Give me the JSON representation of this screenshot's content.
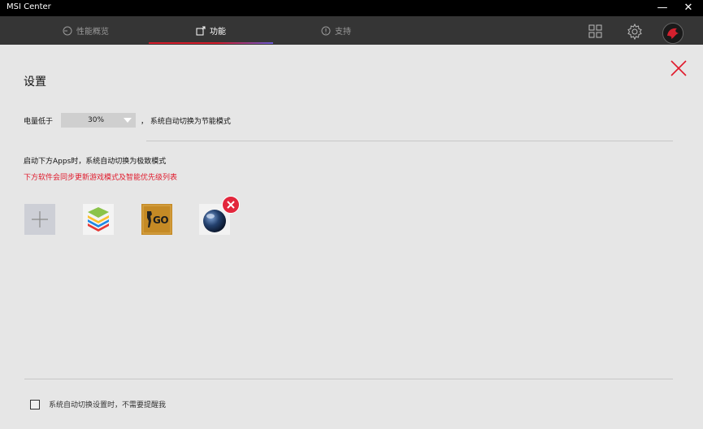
{
  "window": {
    "title": "MSI Center",
    "minimize_glyph": "—",
    "close_glyph": "✕"
  },
  "tabs": [
    {
      "label": "性能概览",
      "icon": "gauge-icon",
      "active": false
    },
    {
      "label": "功能",
      "icon": "feature-icon",
      "active": true
    },
    {
      "label": "支持",
      "icon": "info-icon",
      "active": false
    }
  ],
  "header_icons": [
    "grid-icon",
    "gear-icon",
    "avatar"
  ],
  "page": {
    "title": "设置"
  },
  "battery_row": {
    "prefix": "电量低于",
    "selected": "30%",
    "suffix": "， 系统自动切换为节能模式"
  },
  "apps_section": {
    "description": "启动下方Apps时，系统自动切换为极致模式",
    "warning": "下方软件会同步更新游戏模式及智能优先级列表",
    "apps": [
      {
        "icon": "bluestacks-icon"
      },
      {
        "icon": "csgo-icon",
        "icon_text": "GO"
      },
      {
        "icon": "cinema4d-icon"
      }
    ]
  },
  "footer": {
    "checkbox_label": "系统自动切换设置时，不需要提醒我",
    "checked": false
  },
  "colors": {
    "accent_red": "#e01a2c",
    "background": "#e6e6e6",
    "tabbar": "#353535",
    "titlebar": "#000000"
  }
}
